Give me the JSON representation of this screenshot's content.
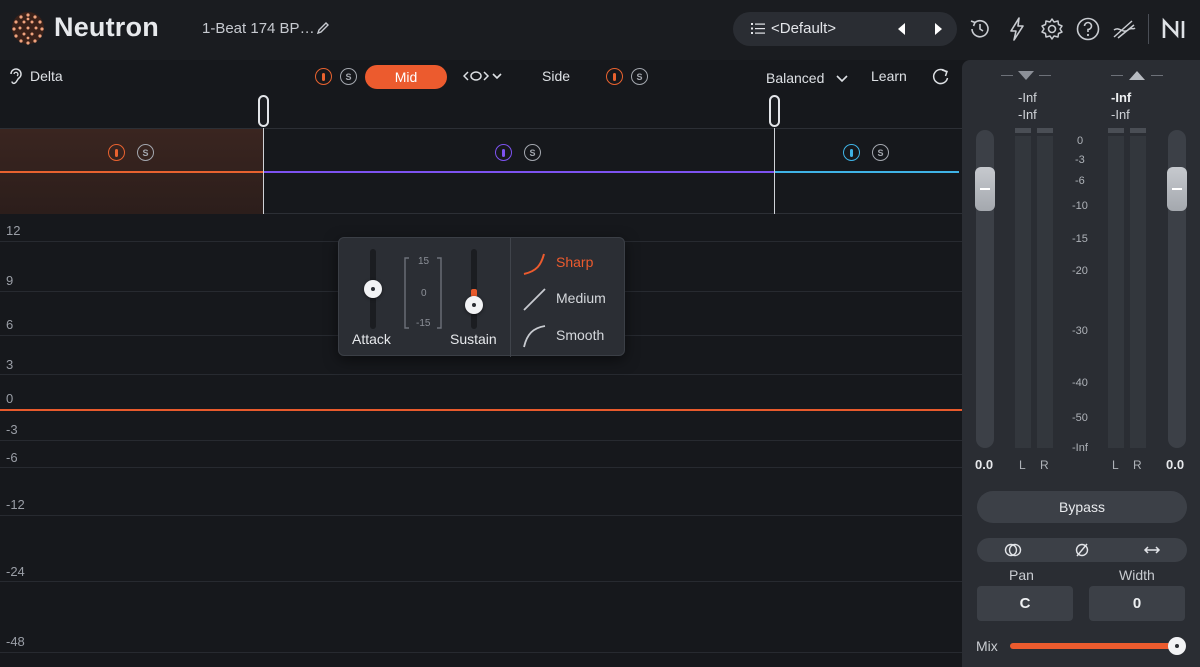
{
  "header": {
    "brand": "Neutron",
    "track_name": "1-Beat 174 BP…",
    "preset": "<Default>",
    "icons": [
      "history-icon",
      "lightning-icon",
      "settings-icon",
      "help-icon",
      "signal-chain-icon",
      "ni-logo-icon"
    ]
  },
  "toolbar": {
    "delta_label": "Delta",
    "mid_label": "Mid",
    "side_label": "Side",
    "balanced_label": "Balanced",
    "learn_label": "Learn",
    "solo_glyph": "S"
  },
  "bands": [
    {
      "color": "#e8622f"
    },
    {
      "color": "#7d52f0"
    },
    {
      "color": "#3fb3e6"
    }
  ],
  "graph": {
    "db_labels": [
      "12",
      "9",
      "6",
      "3",
      "0",
      "-3",
      "-6",
      "-12",
      "-24",
      "-48"
    ],
    "accent": "#e85a2c"
  },
  "popup": {
    "attack_label": "Attack",
    "sustain_label": "Sustain",
    "scale_labels": [
      "15",
      "0",
      "-15"
    ],
    "curves": [
      {
        "label": "Sharp",
        "selected": true
      },
      {
        "label": "Medium",
        "selected": false
      },
      {
        "label": "Smooth",
        "selected": false
      }
    ]
  },
  "output": {
    "input_peak": [
      "-Inf",
      "-Inf"
    ],
    "output_peak": [
      "-Inf",
      "-Inf"
    ],
    "meter_scale": [
      "0",
      "-3",
      "-6",
      "-10",
      "-15",
      "-20",
      "-30",
      "-40",
      "-50",
      "-Inf"
    ],
    "left_label": "L",
    "right_label": "R",
    "input_gain": "0.0",
    "output_gain": "0.0",
    "bypass_label": "Bypass",
    "pan_label": "Pan",
    "width_label": "Width",
    "pan_value": "C",
    "width_value": "0",
    "mix_label": "Mix",
    "mix_value": 1.0
  }
}
